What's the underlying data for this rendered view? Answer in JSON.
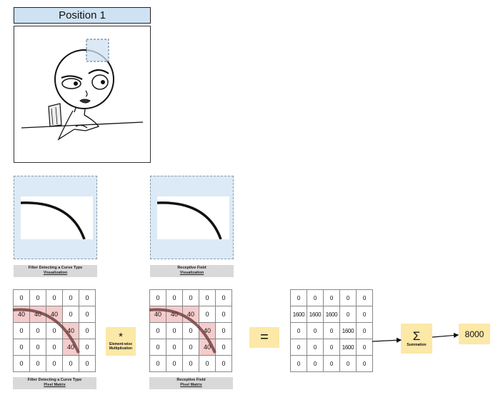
{
  "header": {
    "title": "Position 1"
  },
  "filter_viz": {
    "caption_line1": "Filter Detecting a Curve Type",
    "caption_line2": "Visualization"
  },
  "receptive_viz": {
    "caption_line1": "Receptive Field",
    "caption_line2": "Visualization"
  },
  "filter_matrix": {
    "caption_line1": "Filter Detecting a Curve Type",
    "caption_line2": "Pixel Matrix",
    "rows": [
      [
        "0",
        "0",
        "0",
        "0",
        "0"
      ],
      [
        "40",
        "40",
        "40",
        "0",
        "0"
      ],
      [
        "0",
        "0",
        "0",
        "40",
        "0"
      ],
      [
        "0",
        "0",
        "0",
        "40",
        "0"
      ],
      [
        "0",
        "0",
        "0",
        "0",
        "0"
      ]
    ]
  },
  "receptive_matrix": {
    "caption_line1": "Receptive Field",
    "caption_line2": "Pixel Matrix",
    "rows": [
      [
        "0",
        "0",
        "0",
        "0",
        "0"
      ],
      [
        "40",
        "40",
        "40",
        "0",
        "0"
      ],
      [
        "0",
        "0",
        "0",
        "40",
        "0"
      ],
      [
        "0",
        "0",
        "0",
        "40",
        "0"
      ],
      [
        "0",
        "0",
        "0",
        "0",
        "0"
      ]
    ]
  },
  "product_matrix": {
    "rows": [
      [
        "0",
        "0",
        "0",
        "0",
        "0"
      ],
      [
        "1600",
        "1600",
        "1600",
        "0",
        "0"
      ],
      [
        "0",
        "0",
        "0",
        "1600",
        "0"
      ],
      [
        "0",
        "0",
        "0",
        "1600",
        "0"
      ],
      [
        "0",
        "0",
        "0",
        "0",
        "0"
      ]
    ]
  },
  "operators": {
    "multiply_symbol": "*",
    "multiply_label_1": "Element-wise",
    "multiply_label_2": "Multiplication",
    "equals_symbol": "=",
    "sum_symbol": "Σ",
    "sum_label": "Summation"
  },
  "result": {
    "value": "8000"
  },
  "colors": {
    "highlight": "#f4cccc",
    "panel_blue": "#dbeaf6",
    "operator_yellow": "#fce8a7",
    "header_blue": "#cfe2f3"
  }
}
